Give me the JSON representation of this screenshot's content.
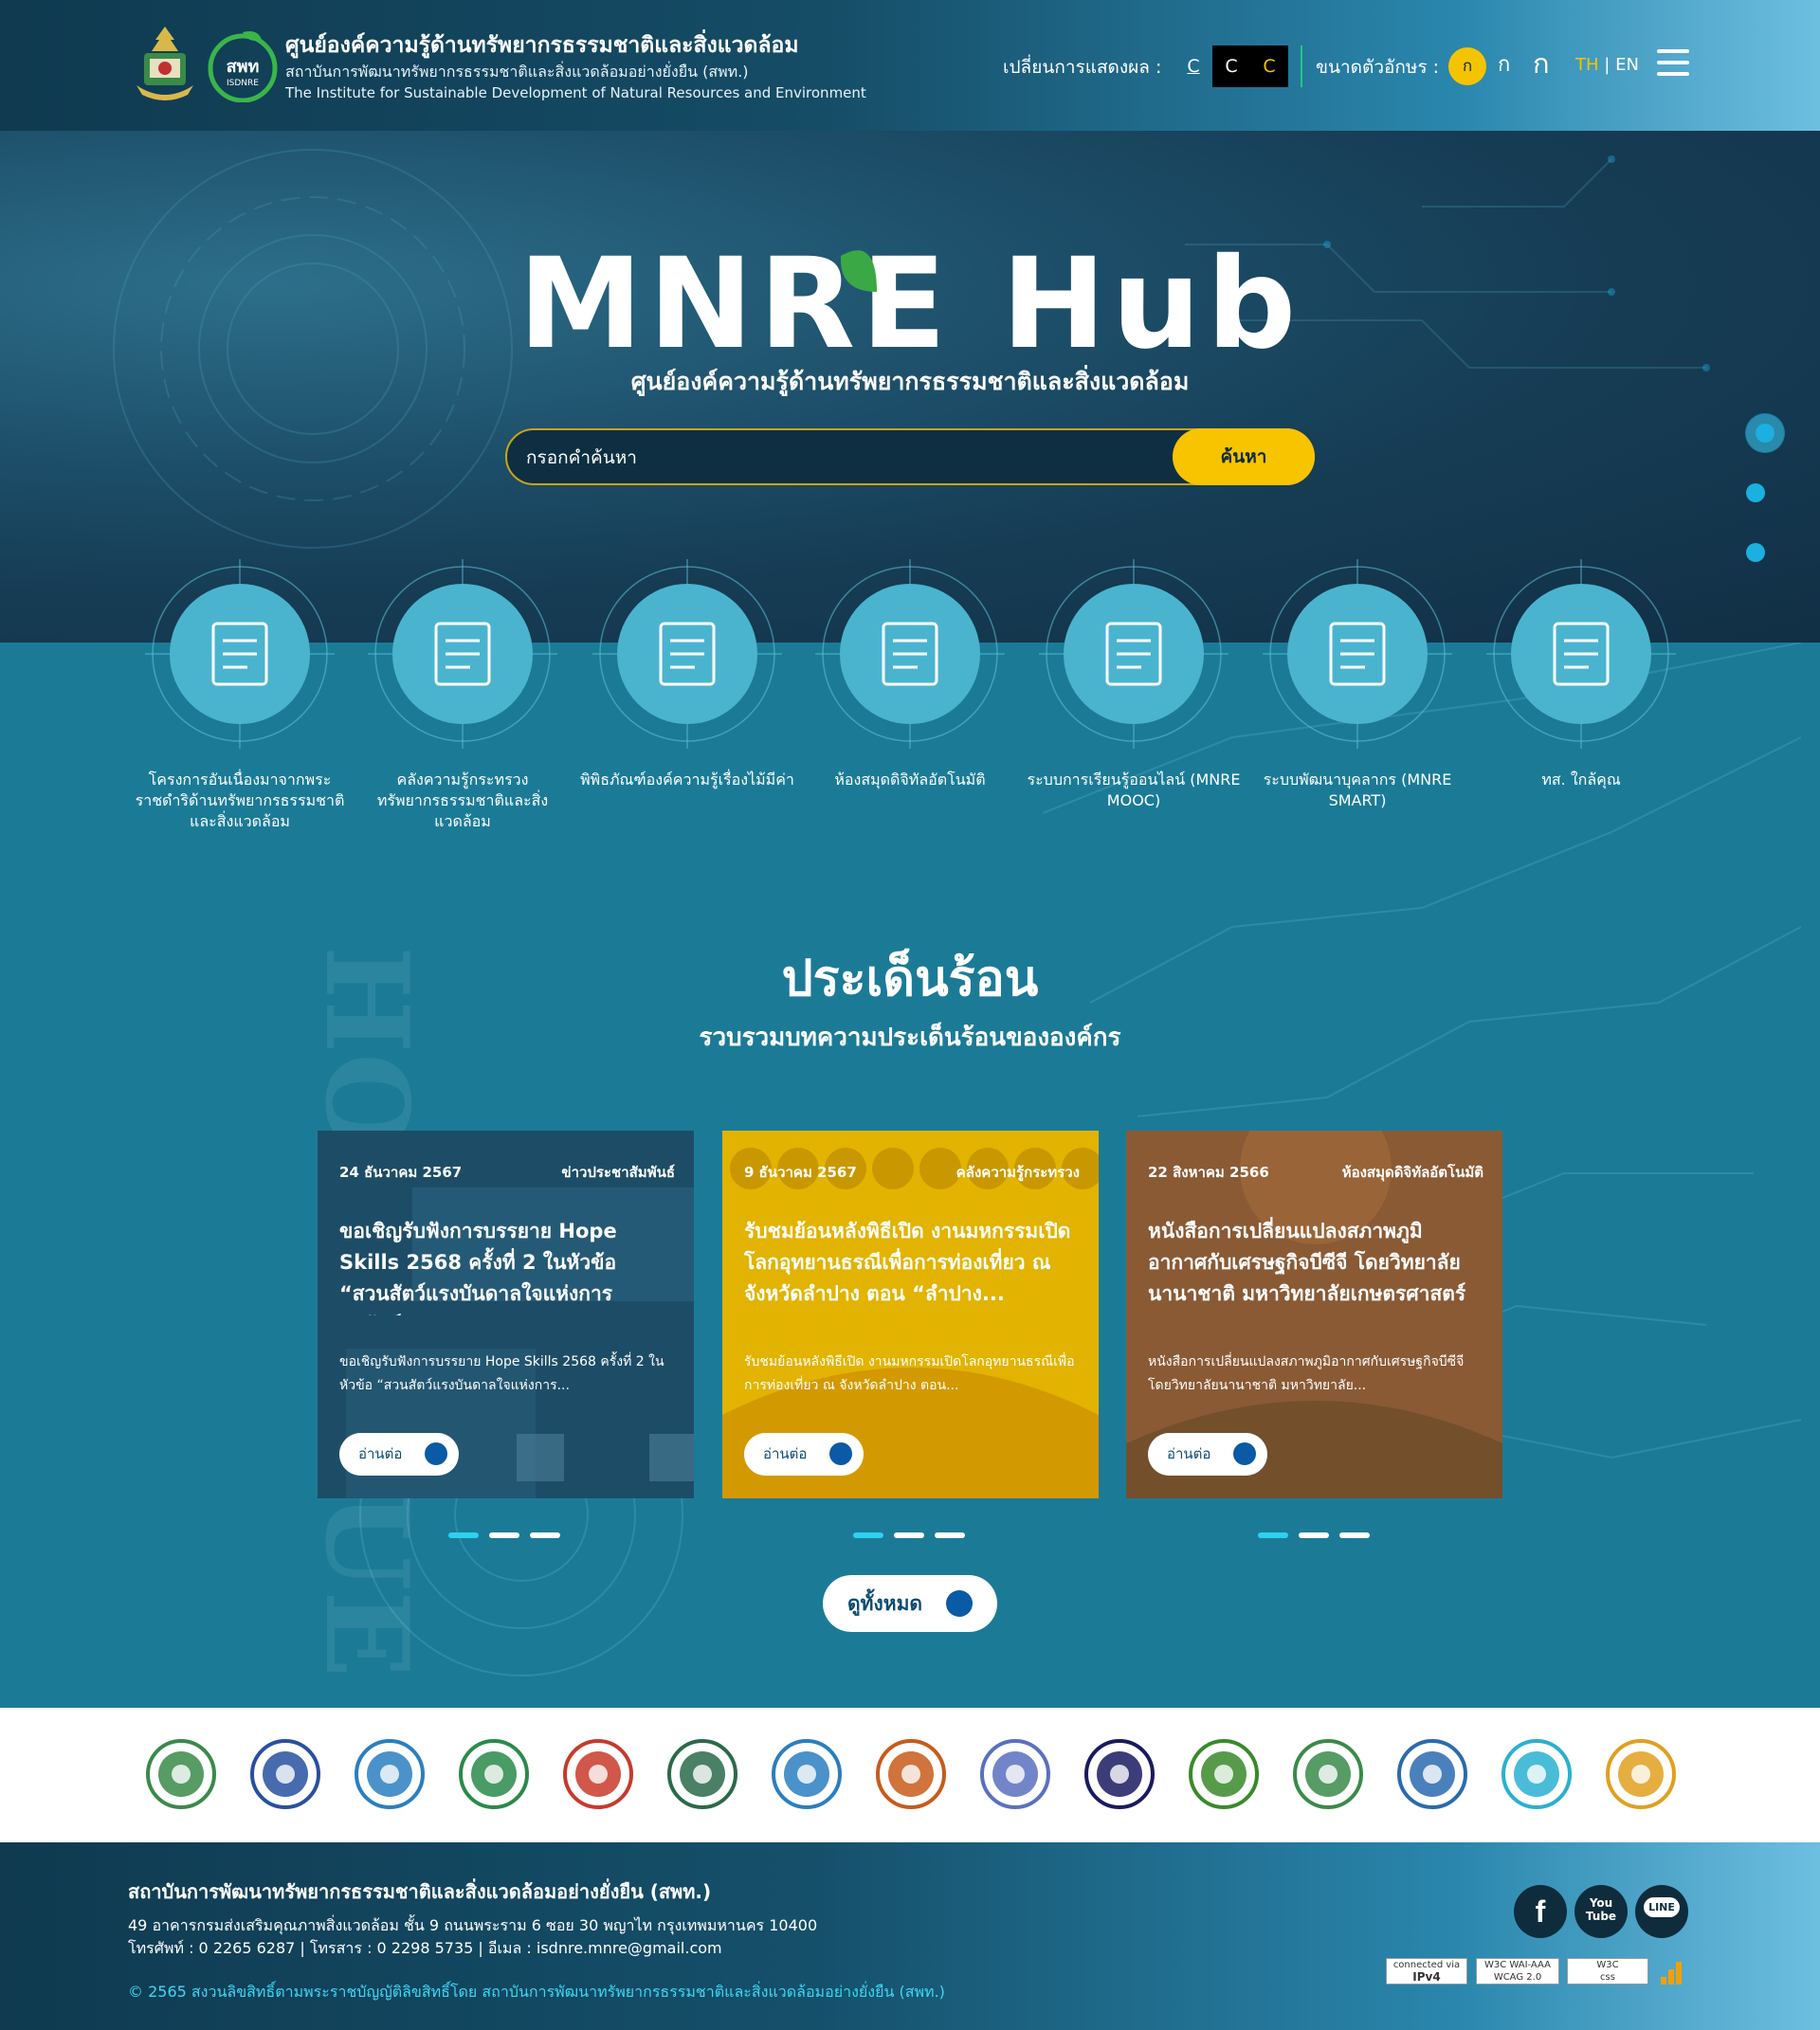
{
  "header": {
    "title": "ศูนย์องค์ความรู้ด้านทรัพยากรธรรมชาติและสิ่งแวดล้อม",
    "subtitle": "สถาบันการพัฒนาทรัพยากรธรรมชาติและสิ่งแวดล้อมอย่างยั่งยืน (สพท.)",
    "subtitle_en": "The Institute for Sustainable Development of Natural Resources and Environment",
    "logo_text": "สพท",
    "logo_text_sub": "ISDNRE",
    "display_label": "เปลี่ยนการแสดงผล :",
    "contrast_options": [
      "C",
      "C",
      "C"
    ],
    "font_size_label": "ขนาดตัวอักษร :",
    "font_sizes": [
      "ก",
      "ก",
      "ก"
    ],
    "lang_th": "TH",
    "lang_sep": "|",
    "lang_en": "EN"
  },
  "hero": {
    "logo_text": "MNRE Hub",
    "subtitle": "ศูนย์องค์ความรู้ด้านทรัพยากรธรรมชาติและสิ่งแวดล้อม",
    "search_placeholder": "กรอกคำค้นหา",
    "search_button": "ค้นหา",
    "slide_count": 3,
    "active_slide": 1
  },
  "quick_links": [
    {
      "label": "โครงการอันเนื่องมาจากพระราชดำริด้านทรัพยากรธรรมชาติและสิ่งแวดล้อม",
      "icon": "scroll-document-icon"
    },
    {
      "label": "คลังความรู้กระทรวงทรัพยากรธรรมชาติและสิ่งแวดล้อม",
      "icon": "brain-lightbulb-icon"
    },
    {
      "label": "พิพิธภัณฑ์องค์ความรู้เรื่องไม้มีค่า",
      "icon": "museum-house-icon"
    },
    {
      "label": "ห้องสมุดดิจิทัลอัตโนมัติ",
      "icon": "digital-library-icon"
    },
    {
      "label": "ระบบการเรียนรู้ออนไลน์ (MNRE MOOC)",
      "icon": "online-learning-icon"
    },
    {
      "label": "ระบบพัฒนาบุคลากร (MNRE SMART)",
      "icon": "people-network-icon"
    },
    {
      "label": "ทส. ใกล้คุณ",
      "icon": "buildings-icon"
    }
  ],
  "hot_issue": {
    "title": "ประเด็นร้อน",
    "subtitle": "รวบรวมบทความประเด็นร้อนขององค์กร",
    "watermark": "HOT ISSUE",
    "cards": [
      {
        "date": "24 ธันวาคม 2567",
        "category": "ข่าวประชาสัมพันธ์",
        "title": "ขอเชิญรับฟังการบรรยาย Hope Skills 2568 ครั้งที่ 2 ในหัวข้อ “สวนสัตว์แรงบันดาลใจแห่งการอนุรักษ์”",
        "excerpt": "ขอเชิญรับฟังการบรรยาย Hope Skills 2568 ครั้งที่ 2 ในหัวข้อ “สวนสัตว์แรงบันดาลใจแห่งการ...",
        "read_more": "อ่านต่อ",
        "accent": "#1d4d66"
      },
      {
        "date": "9 ธันวาคม 2567",
        "category": "คลังความรู้กระทรวง",
        "title": "รับชมย้อนหลังพิธีเปิด งานมหกรรมเปิดโลกอุทยานธรณีเพื่อการท่องเที่ยว ณ จังหวัดลำปาง ตอน “ลำปาง...",
        "excerpt": "รับชมย้อนหลังพิธีเปิด งานมหกรรมเปิดโลกอุทยานธรณีเพื่อการท่องเที่ยว ณ จังหวัดลำปาง ตอน...",
        "read_more": "อ่านต่อ",
        "accent": "#e2b300"
      },
      {
        "date": "22 สิงหาคม 2566",
        "category": "ห้องสมุดดิจิทัลอัตโนมัติ",
        "title": "หนังสือการเปลี่ยนแปลงสภาพภูมิอากาศกับเศรษฐกิจบีซีจี โดยวิทยาลัยนานาชาติ มหาวิทยาลัยเกษตรศาสตร์",
        "excerpt": "หนังสือการเปลี่ยนแปลงสภาพภูมิอากาศกับเศรษฐกิจบีซีจี โดยวิทยาลัยนานาชาติ มหาวิทยาลัย...",
        "read_more": "อ่านต่อ",
        "accent": "#8a5a35"
      }
    ],
    "view_all": "ดูทั้งหมด"
  },
  "partners": [
    "ministry-emblem",
    "dwr-emblem",
    "pcd-emblem",
    "rfd-emblem",
    "dnp-emblem",
    "dmcr-emblem",
    "dgr-emblem",
    "dmr-emblem",
    "onep-emblem",
    "deqp-emblem",
    "forest-emblem",
    "zoo-emblem",
    "water-emblem",
    "c-logo",
    "tgo-emblem"
  ],
  "footer": {
    "org": "สถาบันการพัฒนาทรัพยากรธรรมชาติและสิ่งแวดล้อมอย่างยั่งยืน (สพท.)",
    "address": "49 อาคารกรมส่งเสริมคุณภาพสิ่งแวดล้อม ชั้น 9 ถนนพระราม 6 ซอย 30 พญาไท กรุงเทพมหานคร 10400",
    "contact": "โทรศัพท์ : 0 2265 6287 | โทรสาร : 0 2298 5735 | อีเมล : isdnre.mnre@gmail.com",
    "copyright": "© 2565 สงวนลิขสิทธิ์ตามพระราชบัญญัติลิขสิทธิ์โดย สถาบันการพัฒนาทรัพยากรธรรมชาติและสิ่งแวดล้อมอย่างยั่งยืน (สพท.)",
    "social": [
      "facebook-icon",
      "youtube-icon",
      "line-icon"
    ],
    "social_text": [
      "f",
      "You Tube",
      "LINE"
    ],
    "badges": [
      {
        "name": "ipv4-badge",
        "line1": "connected via",
        "line2": "IPv4"
      },
      {
        "name": "wcag-badge",
        "line1": "W3C WAI-AAA",
        "line2": "WCAG 2.0"
      },
      {
        "name": "w3c-css-badge",
        "line1": "W3C",
        "line2": "css"
      }
    ]
  },
  "colors": {
    "accent_yellow": "#f8c400",
    "accent_cyan": "#2fd0f0",
    "section_bg": "#1b7b97",
    "header_dark": "#0f3a50"
  }
}
